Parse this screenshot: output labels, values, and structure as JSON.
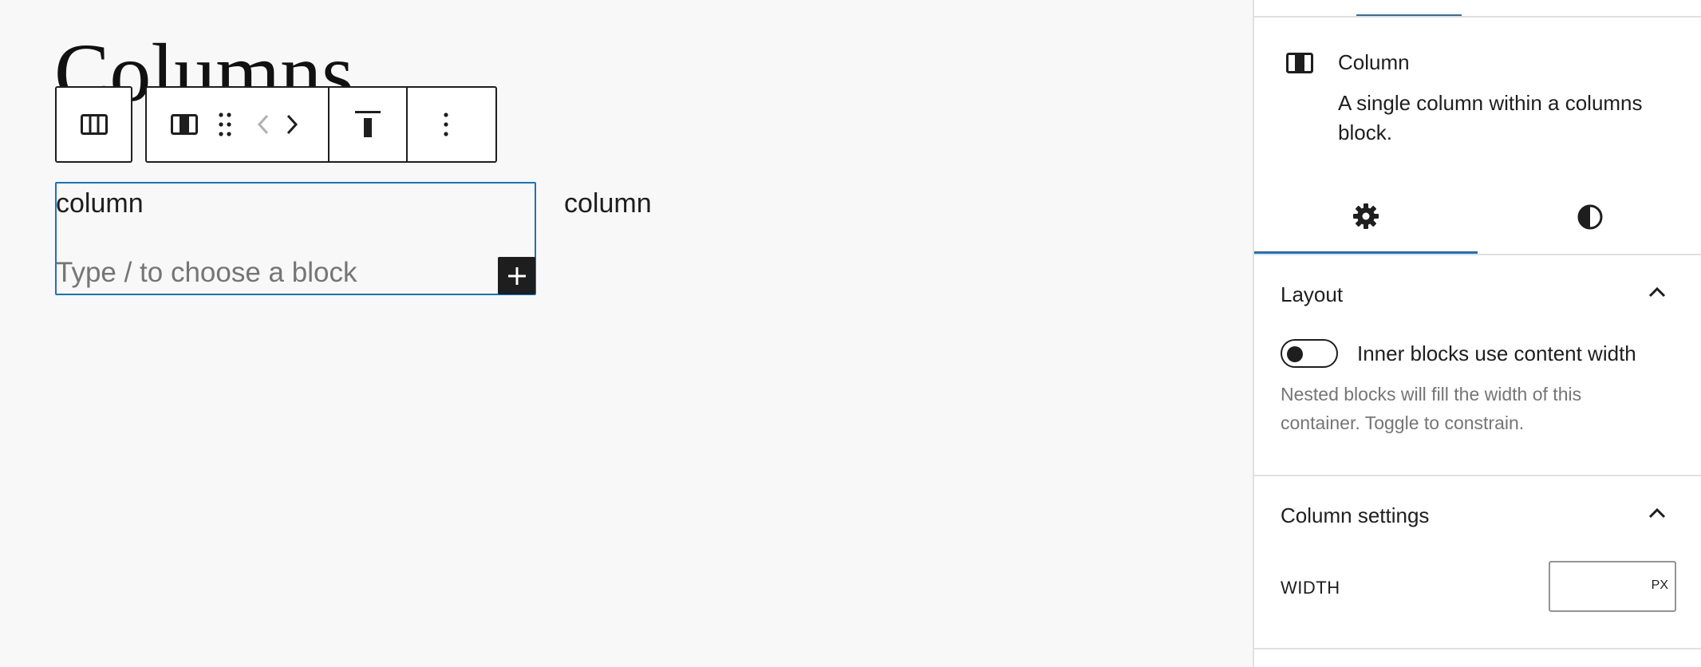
{
  "editor": {
    "title": "Columns",
    "toolbar": {
      "parent_icon": "columns-icon",
      "block_icon": "column-icon",
      "drag_icon": "drag-handle-icon",
      "move_left_icon": "chevron-left-icon",
      "move_right_icon": "chevron-right-icon",
      "align_icon": "align-top-icon",
      "more_icon": "more-vertical-icon"
    },
    "columns": [
      {
        "text": "column",
        "placeholder": "Type / to choose a block"
      },
      {
        "text": "column"
      }
    ]
  },
  "sidebar": {
    "block_card": {
      "title": "Column",
      "description_line1": "A single column within a columns",
      "description_line2": "block."
    },
    "tabs": [
      {
        "icon": "gear-icon",
        "active": true
      },
      {
        "icon": "contrast-icon",
        "active": false
      }
    ],
    "layout_panel": {
      "title": "Layout",
      "toggle_label": "Inner blocks use content width",
      "toggle_on": false,
      "help_line1": "Nested blocks will fill the width of this",
      "help_line2": "container. Toggle to constrain."
    },
    "column_settings_panel": {
      "title": "Column settings",
      "width_label": "WIDTH",
      "width_value": "",
      "width_unit": "PX"
    },
    "colors": {
      "accent": "#2271b1",
      "text": "#1e1e1e",
      "muted": "#757575"
    }
  }
}
